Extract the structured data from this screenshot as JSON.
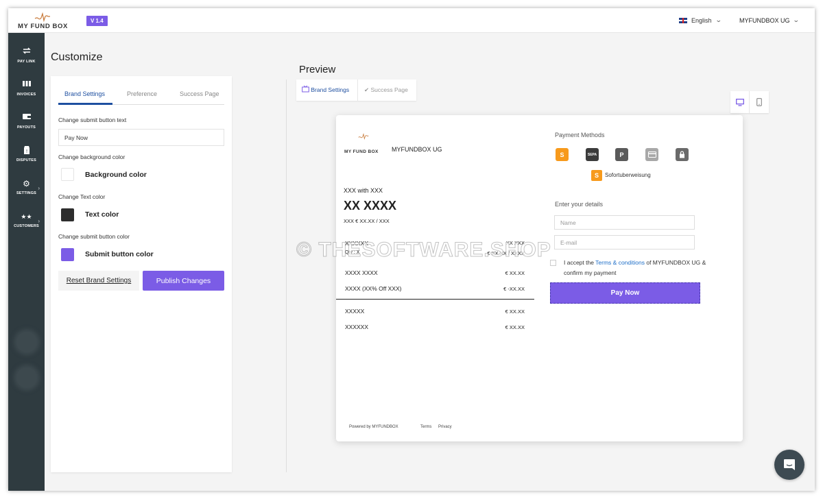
{
  "app": {
    "logo_text": "MY FUND BOX",
    "version": "V 1.4",
    "language": "English",
    "company": "MYFUNDBOX UG"
  },
  "sidebar": {
    "items": [
      {
        "label": "PAY LINK",
        "icon": "arrows-exchange-icon"
      },
      {
        "label": "INVOICES",
        "icon": "invoices-icon"
      },
      {
        "label": "PAYOUTS",
        "icon": "wallet-icon"
      },
      {
        "label": "DISPUTES",
        "icon": "dispute-icon"
      },
      {
        "label": "SETTINGS",
        "icon": "gear-icon"
      },
      {
        "label": "CUSTOMERS",
        "icon": "customers-icon"
      }
    ]
  },
  "customize": {
    "title": "Customize",
    "tabs": [
      "Brand Settings",
      "Preference",
      "Success Page"
    ],
    "submit_text_label": "Change submit button text",
    "submit_text_value": "Pay Now",
    "bg_color_label": "Change background color",
    "bg_color_name": "Background color",
    "bg_color_value": "#ffffff",
    "text_color_label": "Change Text color",
    "text_color_name": "Text color",
    "text_color_value": "#2d2d2d",
    "submit_color_label": "Change submit button color",
    "submit_color_name": "Submit button color",
    "submit_color_value": "#7b5ce6",
    "reset_button": "Reset Brand Settings",
    "publish_button": "Publish Changes"
  },
  "preview": {
    "title": "Preview",
    "tabs": [
      "Brand Settings",
      "Success Page"
    ],
    "card": {
      "logo_text": "MY FUND BOX",
      "company": "MYFUNDBOX UG",
      "product_line": "XXX with XXX",
      "big_amount": "XX XXXX",
      "unit_price": "XXX € XX.XX / XXX",
      "item_name": "XXXXXX",
      "item_amount": "XX XXX",
      "item_qty": "Qty : X",
      "item_price": "€ XX.XX / XXXX",
      "subtotal_label": "XXXX XXXX",
      "subtotal_value": "€ XX.XX",
      "discount_label": "XXXX (XX% Off XXX)",
      "discount_value": "€ -XX.XX",
      "total1_label": "XXXXX",
      "total1_value": "€ XX.XX",
      "total2_label": "XXXXXX",
      "total2_value": "€ XX.XX",
      "payment_methods_title": "Payment Methods",
      "payment_methods": [
        {
          "name": "sofort-icon",
          "glyph": "S",
          "color": "#f79a1c"
        },
        {
          "name": "sepa-icon",
          "glyph": "SEPA",
          "color": "#3b3b3b"
        },
        {
          "name": "paypal-icon",
          "glyph": "P",
          "color": "#5a5a5a"
        },
        {
          "name": "card-icon",
          "glyph": "▭",
          "color": "#9a9a9a"
        },
        {
          "name": "lock-icon",
          "glyph": "🔒",
          "color": "#6a6a6a"
        }
      ],
      "selected_method": "Sofortuberweisung",
      "details_title": "Enter your details",
      "name_placeholder": "Name",
      "email_placeholder": "E-mail",
      "terms_prefix": "I accept the",
      "terms_link": "Terms & conditions",
      "terms_suffix": "of MYFUNDBOX UG & confirm my payment",
      "pay_button": "Pay Now",
      "powered_by": "Powered by MYFUNDBOX",
      "footer_terms": "Terms",
      "footer_privacy": "Privacy"
    }
  },
  "watermark": "© THESOFTWARE.SHOP",
  "colors": {
    "accent": "#7b5ce6",
    "sidebar": "#2f3b40",
    "tab_active": "#1e4fa0",
    "link": "#1e6ec8"
  }
}
